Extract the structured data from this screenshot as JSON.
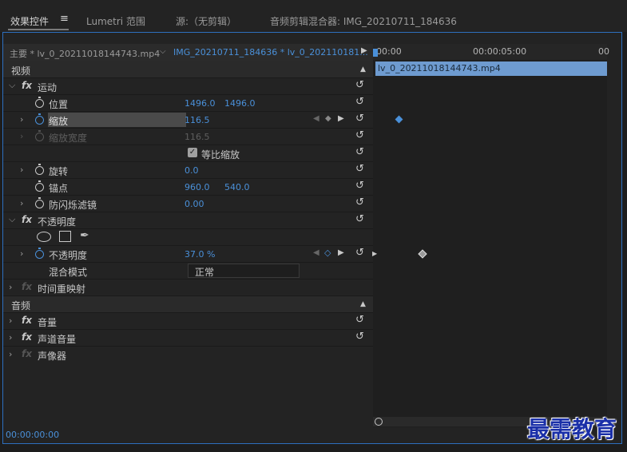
{
  "tabs": [
    {
      "label": "效果控件",
      "menu_icon": "hamburger-icon"
    },
    {
      "label": "Lumetri 范围"
    },
    {
      "label": "源:（无剪辑）"
    },
    {
      "label": "音频剪辑混合器: IMG_20210711_184636"
    }
  ],
  "source_bar": {
    "main": "主要 * lv_0_20211018144743.mp4",
    "clip": "IMG_20210711_184636 * lv_0_202110181..."
  },
  "sections": {
    "video": "视频",
    "audio": "音频"
  },
  "effects": {
    "motion": {
      "name": "运动",
      "position": {
        "label": "位置",
        "x": "1496.0",
        "y": "1496.0"
      },
      "scale": {
        "label": "缩放",
        "value": "116.5"
      },
      "scale_width": {
        "label": "缩放宽度",
        "value": "116.5"
      },
      "uniform_scale": {
        "label": "等比缩放",
        "checked": true
      },
      "rotation": {
        "label": "旋转",
        "value": "0.0"
      },
      "anchor": {
        "label": "锚点",
        "x": "960.0",
        "y": "540.0"
      },
      "anti_flicker": {
        "label": "防闪烁滤镜",
        "value": "0.00"
      }
    },
    "opacity": {
      "name": "不透明度",
      "opacity": {
        "label": "不透明度",
        "value": "37.0 %"
      },
      "blend_mode": {
        "label": "混合模式",
        "value": "正常"
      }
    },
    "time_remap": {
      "name": "时间重映射"
    },
    "volume": {
      "name": "音量"
    },
    "channel_volume": {
      "name": "声道音量"
    },
    "panner": {
      "name": "声像器"
    }
  },
  "timeline": {
    "ticks": [
      "00:00",
      "00:00:05:00",
      "00"
    ],
    "clip_name": "lv_0_20211018144743.mp4"
  },
  "status": {
    "timecode": "00:00:00:00"
  },
  "watermark": "最需教育",
  "colors": {
    "accent": "#4a90d9",
    "clip": "#6e9bd0"
  }
}
